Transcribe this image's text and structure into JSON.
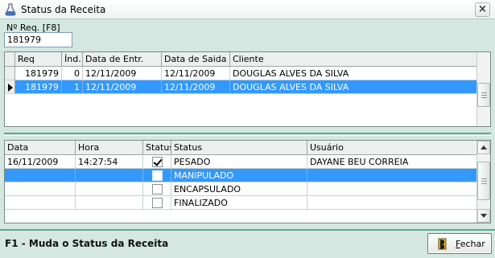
{
  "window": {
    "title": "Status da Receita",
    "close_glyph": "×"
  },
  "req": {
    "label": "Nº Req. [F8]",
    "value": "181979"
  },
  "grid_receitas": {
    "columns": [
      "Req",
      "Índ.",
      "Data de Entr.",
      "Data de Saida",
      "Cliente"
    ],
    "rows": [
      {
        "req": "181979",
        "ind": "0",
        "entrada": "12/11/2009",
        "saida": "12/11/2009",
        "cliente": "DOUGLAS ALVES DA SILVA",
        "selected": false
      },
      {
        "req": "181979",
        "ind": "1",
        "entrada": "12/11/2009",
        "saida": "12/11/2009",
        "cliente": "DOUGLAS ALVES DA SILVA",
        "selected": true
      }
    ]
  },
  "grid_status": {
    "columns": [
      "Data",
      "Hora",
      "Status",
      "Status",
      "Usuário"
    ],
    "rows": [
      {
        "data": "16/11/2009",
        "hora": "14:27:54",
        "checked": true,
        "status": "PESADO",
        "usuario": "DAYANE BEU CORREIA",
        "selected": false
      },
      {
        "data": "",
        "hora": "",
        "checked": false,
        "status": "MANIPULADO",
        "usuario": "",
        "selected": true
      },
      {
        "data": "",
        "hora": "",
        "checked": false,
        "status": "ENCAPSULADO",
        "usuario": "",
        "selected": false
      },
      {
        "data": "",
        "hora": "",
        "checked": false,
        "status": "FINALIZADO",
        "usuario": "",
        "selected": false
      }
    ]
  },
  "footer": {
    "help_text": "F1 - Muda o Status da Receita",
    "close_button_label": "Fechar",
    "close_button_mnemonic": "F",
    "close_button_rest": "echar"
  },
  "icons": {
    "app": "flask-icon",
    "close_button": "door-exit-icon"
  },
  "colors": {
    "background": "#d4e7e1",
    "selection": "#3399ff",
    "divider": "#5aa892"
  }
}
